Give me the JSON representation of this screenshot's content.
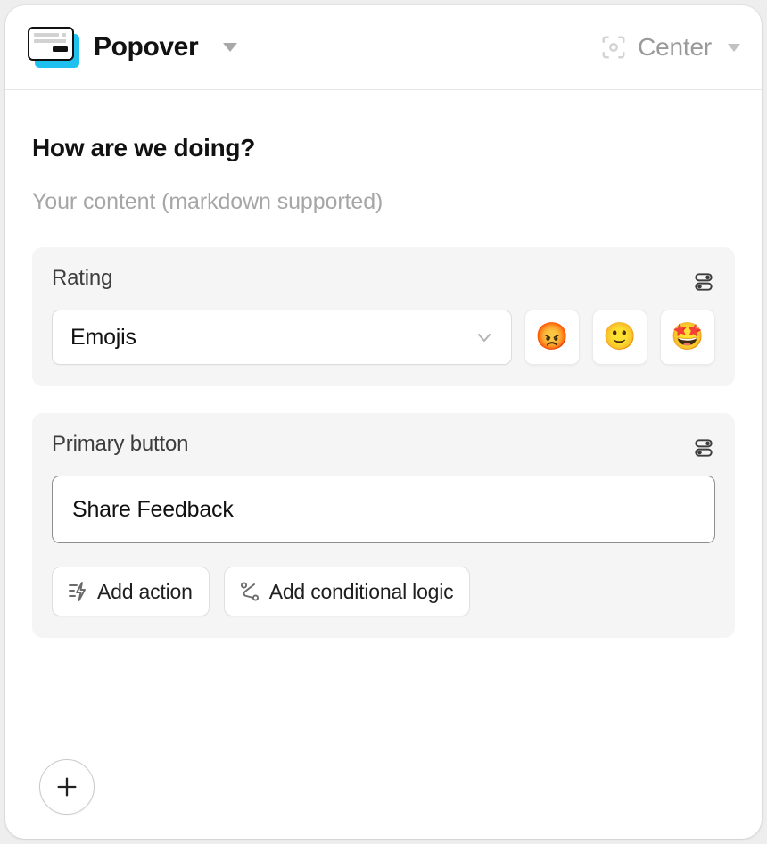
{
  "header": {
    "icon_name": "popover-card-icon",
    "icon_accent_color": "#1ec0f0",
    "title": "Popover",
    "title_caret": "caret-down-icon",
    "position_icon": "scan-focus-icon",
    "position_label": "Center",
    "position_caret": "caret-down-icon"
  },
  "content": {
    "title": "How are we doing?",
    "placeholder": "Your content (markdown supported)"
  },
  "sections": [
    {
      "label": "Rating",
      "settings_icon": "sliders-icon",
      "select": {
        "value": "Emojis",
        "chevron": "chevron-down-icon"
      },
      "emojis": [
        {
          "name": "angry-face-emoji",
          "glyph": "😡"
        },
        {
          "name": "slightly-smiling-face-emoji",
          "glyph": "🙂"
        },
        {
          "name": "star-struck-emoji",
          "glyph": "🤩"
        }
      ]
    },
    {
      "label": "Primary button",
      "settings_icon": "sliders-icon",
      "input": {
        "value": "Share Feedback"
      },
      "chips": [
        {
          "name": "add-action-button",
          "icon": "zap-lines-icon",
          "label": "Add action"
        },
        {
          "name": "add-conditional-logic-button",
          "icon": "workflow-branch-icon",
          "label": "Add conditional logic"
        }
      ]
    }
  ],
  "footer": {
    "add_block_label": "+",
    "add_block_icon": "plus-icon"
  },
  "colors": {
    "panel_bg": "#ffffff",
    "page_bg": "#eeeeee",
    "card_bg": "#f5f5f5",
    "accent": "#1ec0f0",
    "muted_text": "#a6a6a6",
    "border": "#e7e7e7"
  }
}
